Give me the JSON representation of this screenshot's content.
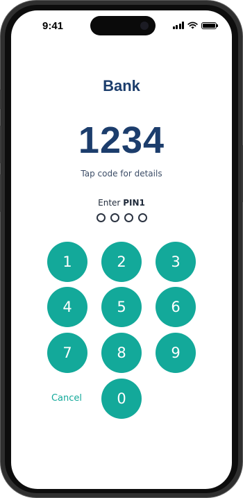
{
  "status_bar": {
    "time": "9:41",
    "icons": [
      "cellular-signal-icon",
      "wifi-icon",
      "battery-icon"
    ]
  },
  "header": {
    "title": "Bank"
  },
  "display": {
    "code": "1234",
    "hint": "Tap code for details"
  },
  "pin_entry": {
    "prompt_prefix": "Enter ",
    "prompt_strong": "PIN1",
    "dots_total": 4,
    "dots_filled": 0
  },
  "keypad": {
    "keys": [
      "1",
      "2",
      "3",
      "4",
      "5",
      "6",
      "7",
      "8",
      "9",
      "0"
    ],
    "cancel_label": "Cancel"
  },
  "colors": {
    "accent": "#13a99a",
    "title": "#1c3d6c"
  }
}
